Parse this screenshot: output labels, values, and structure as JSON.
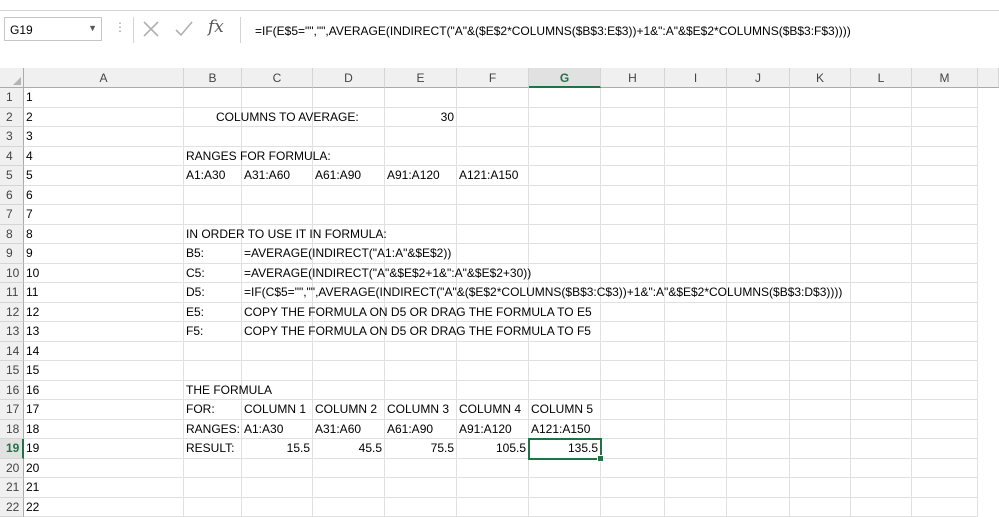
{
  "formula_bar": {
    "name_box": "G19",
    "formula": "=IF(E$5=\"\",\"\",AVERAGE(INDIRECT(\"A\"&($E$2*COLUMNS($B$3:E$3))+1&\":A\"&$E$2*COLUMNS($B$3:F$3))))",
    "fx_label": "fx"
  },
  "columns": [
    "A",
    "B",
    "C",
    "D",
    "E",
    "F",
    "G",
    "H",
    "I",
    "J",
    "K",
    "L",
    "M"
  ],
  "selected_column": "G",
  "rows": [
    "1",
    "2",
    "3",
    "4",
    "5",
    "6",
    "7",
    "8",
    "9",
    "10",
    "11",
    "12",
    "13",
    "14",
    "15",
    "16",
    "17",
    "18",
    "19",
    "20",
    "21",
    "22"
  ],
  "selected_row": "19",
  "cells": {
    "A1": "1",
    "A2": "2",
    "A3": "3",
    "A4": "4",
    "A5": "5",
    "A6": "6",
    "A7": "7",
    "A8": "8",
    "A9": "9",
    "A10": "10",
    "A11": "11",
    "A12": "12",
    "A13": "13",
    "A14": "14",
    "A15": "15",
    "A16": "16",
    "A17": "17",
    "A18": "18",
    "A19": "19",
    "A20": "20",
    "A21": "21",
    "A22": "22",
    "B2": "COLUMNS TO AVERAGE:",
    "E2": "30",
    "B4": "RANGES FOR FORMULA:",
    "B5": "A1:A30",
    "C5": "A31:A60",
    "D5": "A61:A90",
    "E5": "A91:A120",
    "F5": "A121:A150",
    "B8": "IN ORDER TO USE IT IN FORMULA:",
    "B9": "B5:",
    "C9": "=AVERAGE(INDIRECT(\"A1:A\"&$E$2))",
    "B10": "C5:",
    "C10": "=AVERAGE(INDIRECT(\"A\"&$E$2+1&\":A\"&$E$2+30))",
    "B11": "D5:",
    "C11": "=IF(C$5=\"\",\"\",AVERAGE(INDIRECT(\"A\"&($E$2*COLUMNS($B$3:C$3))+1&\":A\"&$E$2*COLUMNS($B$3:D$3))))",
    "B12": "E5:",
    "C12": "COPY THE FORMULA ON D5 OR DRAG THE FORMULA TO E5",
    "B13": "F5:",
    "C13": "COPY THE FORMULA ON D5 OR DRAG THE FORMULA TO F5",
    "B16": "THE FORMULA",
    "B17": "FOR:",
    "C17": "COLUMN 1",
    "D17": "COLUMN 2",
    "E17": "COLUMN 3",
    "F17": "COLUMN 4",
    "G17": "COLUMN 5",
    "B18": "RANGES:",
    "C18": "A1:A30",
    "D18": "A31:A60",
    "E18": "A61:A90",
    "F18": "A91:A120",
    "G18": "A121:A150",
    "B19": "RESULT:",
    "C19": "15.5",
    "D19": "45.5",
    "E19": "75.5",
    "F19": "105.5",
    "G19": "135.5"
  },
  "colors": {
    "accent": "#217346"
  }
}
